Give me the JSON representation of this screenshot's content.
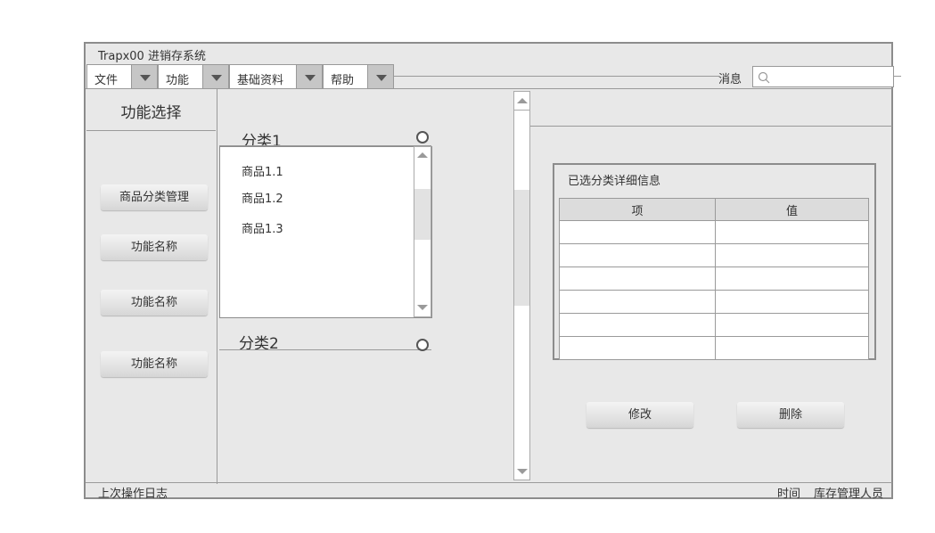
{
  "window": {
    "title": "Trapx00 进销存系统"
  },
  "menu": [
    {
      "label": "文件"
    },
    {
      "label": "功能"
    },
    {
      "label": "基础资料"
    },
    {
      "label": "帮助"
    }
  ],
  "header": {
    "message_label": "消息",
    "search_placeholder": ""
  },
  "sidebar": {
    "title": "功能选择",
    "buttons": [
      {
        "label": "商品分类管理"
      },
      {
        "label": "功能名称"
      },
      {
        "label": "功能名称"
      },
      {
        "label": "功能名称"
      }
    ]
  },
  "tree": {
    "groups": [
      {
        "label": "分类1",
        "items": [
          "商品1.1",
          "商品1.2",
          "商品1.3"
        ]
      },
      {
        "label": "分类2",
        "items": []
      }
    ]
  },
  "detail": {
    "title": "已选分类详细信息",
    "columns": [
      "项",
      "值"
    ],
    "rows": [
      [
        "",
        ""
      ],
      [
        "",
        ""
      ],
      [
        "",
        ""
      ],
      [
        "",
        ""
      ],
      [
        "",
        ""
      ],
      [
        "",
        ""
      ]
    ]
  },
  "actions": {
    "edit_label": "修改",
    "delete_label": "删除"
  },
  "status": {
    "left": "上次操作日志",
    "time_label": "时间",
    "user_label": "库存管理人员"
  }
}
